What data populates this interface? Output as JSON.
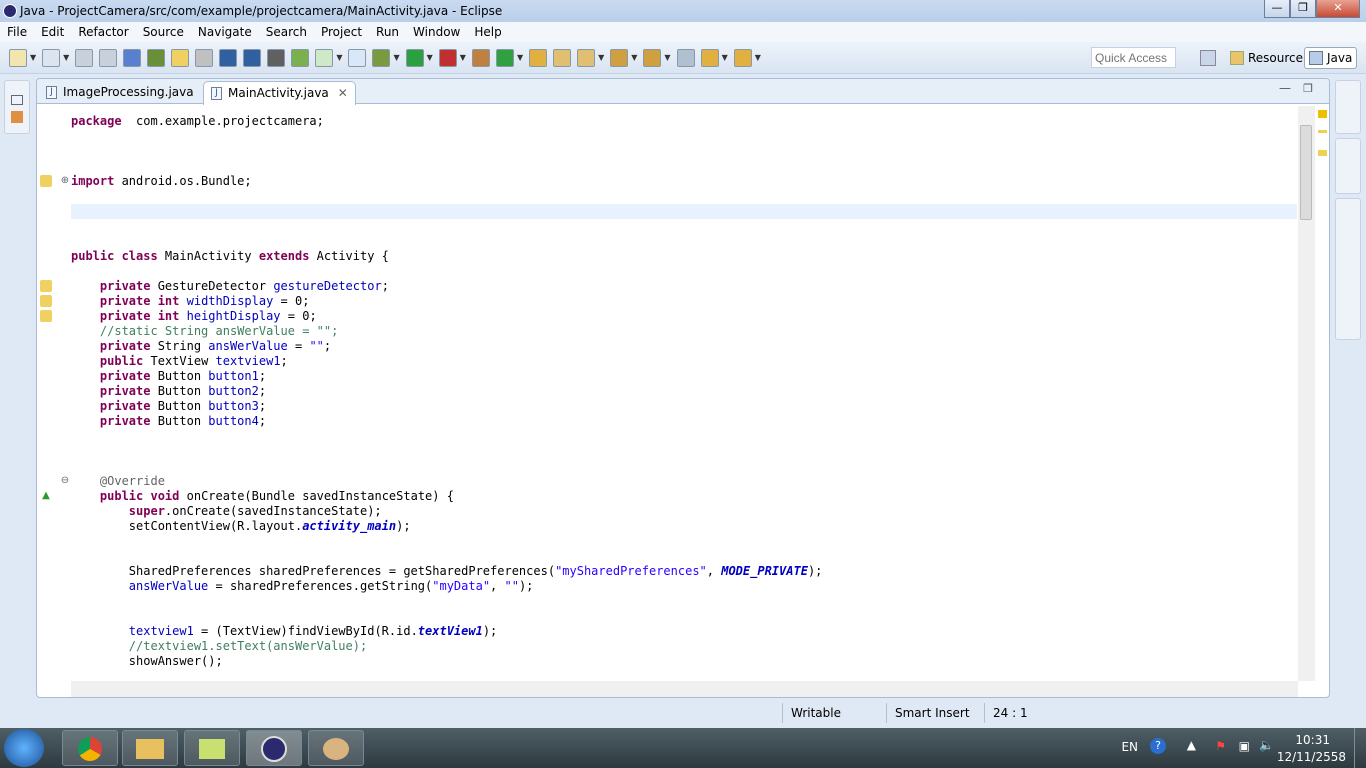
{
  "window": {
    "title": "Java - ProjectCamera/src/com/example/projectcamera/MainActivity.java - Eclipse",
    "buttons": [
      "minimize",
      "restore",
      "close"
    ]
  },
  "menu": [
    "File",
    "Edit",
    "Refactor",
    "Source",
    "Navigate",
    "Search",
    "Project",
    "Run",
    "Window",
    "Help"
  ],
  "toolbar": {
    "quick_access_placeholder": "Quick Access",
    "perspectives": [
      {
        "label": "Resource",
        "active": false
      },
      {
        "label": "Java",
        "active": true
      }
    ]
  },
  "editor": {
    "tabs": [
      {
        "label": "ImageProcessing.java",
        "active": false
      },
      {
        "label": "MainActivity.java",
        "active": true
      }
    ],
    "lines": [
      {
        "row": 0,
        "tokens": [
          [
            "kw",
            "package"
          ],
          [
            "",
            "  com.example.projectcamera;"
          ]
        ]
      },
      {
        "row": 4,
        "tokens": [
          [
            "kw",
            "import"
          ],
          [
            "",
            " android.os.Bundle;"
          ]
        ],
        "fold": "plus"
      },
      {
        "row": 6,
        "tokens": [],
        "current": true
      },
      {
        "row": 9,
        "tokens": [
          [
            "kw",
            "public class"
          ],
          [
            "",
            " MainActivity "
          ],
          [
            "kw",
            "extends"
          ],
          [
            "",
            " Activity {"
          ]
        ]
      },
      {
        "row": 11,
        "tokens": [
          [
            "",
            "    "
          ],
          [
            "kw",
            "private"
          ],
          [
            "",
            " GestureDetector "
          ],
          [
            "fd",
            "gestureDetector"
          ],
          [
            "",
            ";"
          ]
        ]
      },
      {
        "row": 12,
        "tokens": [
          [
            "",
            "    "
          ],
          [
            "kw",
            "private int"
          ],
          [
            " ",
            ""
          ],
          [
            "fd",
            " widthDisplay"
          ],
          [
            "",
            " = 0;"
          ]
        ]
      },
      {
        "row": 13,
        "tokens": [
          [
            "",
            "    "
          ],
          [
            "kw",
            "private int"
          ],
          [
            "fd",
            " heightDisplay"
          ],
          [
            "",
            " = 0;"
          ]
        ]
      },
      {
        "row": 14,
        "tokens": [
          [
            "cm",
            "    //static String ansWerValue = \"\";"
          ]
        ]
      },
      {
        "row": 15,
        "tokens": [
          [
            "",
            "    "
          ],
          [
            "kw",
            "private"
          ],
          [
            "",
            " String "
          ],
          [
            "fd",
            "ansWerValue"
          ],
          [
            "",
            " = "
          ],
          [
            "st",
            "\"\""
          ],
          [
            "",
            ";"
          ]
        ]
      },
      {
        "row": 16,
        "tokens": [
          [
            "",
            "    "
          ],
          [
            "kw",
            "public"
          ],
          [
            "",
            " TextView "
          ],
          [
            "fd",
            "textview1"
          ],
          [
            "",
            ";"
          ]
        ]
      },
      {
        "row": 17,
        "tokens": [
          [
            "",
            "    "
          ],
          [
            "kw",
            "private"
          ],
          [
            "",
            " Button "
          ],
          [
            "fd",
            "button1"
          ],
          [
            "",
            ";"
          ]
        ]
      },
      {
        "row": 18,
        "tokens": [
          [
            "",
            "    "
          ],
          [
            "kw",
            "private"
          ],
          [
            "",
            " Button "
          ],
          [
            "fd",
            "button2"
          ],
          [
            "",
            ";"
          ]
        ]
      },
      {
        "row": 19,
        "tokens": [
          [
            "",
            "    "
          ],
          [
            "kw",
            "private"
          ],
          [
            "",
            " Button "
          ],
          [
            "fd",
            "button3"
          ],
          [
            "",
            ";"
          ]
        ]
      },
      {
        "row": 20,
        "tokens": [
          [
            "",
            "    "
          ],
          [
            "kw",
            "private"
          ],
          [
            "",
            " Button "
          ],
          [
            "fd",
            "button4"
          ],
          [
            "",
            ";"
          ]
        ]
      },
      {
        "row": 24,
        "tokens": [
          [
            "an",
            "    @Override"
          ]
        ],
        "fold": "minus"
      },
      {
        "row": 25,
        "tokens": [
          [
            "",
            "    "
          ],
          [
            "kw",
            "public void"
          ],
          [
            "",
            " onCreate(Bundle "
          ],
          [
            "",
            "savedInstanceState) {"
          ]
        ]
      },
      {
        "row": 26,
        "tokens": [
          [
            "",
            "        "
          ],
          [
            "kw",
            "super"
          ],
          [
            "",
            ".onCreate(savedInstanceState);"
          ]
        ]
      },
      {
        "row": 27,
        "tokens": [
          [
            "",
            "        setContentView(R.layout."
          ],
          [
            "si",
            "activity_main"
          ],
          [
            "",
            ");"
          ]
        ]
      },
      {
        "row": 30,
        "tokens": [
          [
            "",
            "        SharedPreferences sharedPreferences = getSharedPreferences("
          ],
          [
            "st",
            "\"mySharedPreferences\""
          ],
          [
            "",
            ", "
          ],
          [
            "si",
            "MODE_PRIVATE"
          ],
          [
            "",
            ");"
          ]
        ]
      },
      {
        "row": 31,
        "tokens": [
          [
            "fd",
            "        ansWerValue"
          ],
          [
            "",
            " = sharedPreferences.getString("
          ],
          [
            "st",
            "\"myData\""
          ],
          [
            "",
            ", "
          ],
          [
            "st",
            "\"\""
          ],
          [
            "",
            ");"
          ]
        ]
      },
      {
        "row": 34,
        "tokens": [
          [
            "fd",
            "        textview1"
          ],
          [
            "",
            " = (TextView)findViewById(R.id."
          ],
          [
            "si",
            "textView1"
          ],
          [
            "",
            ");"
          ]
        ]
      },
      {
        "row": 35,
        "tokens": [
          [
            "cm",
            "        //textview1.setText(ansWerValue);"
          ]
        ]
      },
      {
        "row": 36,
        "tokens": [
          [
            "",
            "        showAnswer();"
          ]
        ]
      }
    ]
  },
  "status": {
    "mode": "Writable",
    "insert": "Smart Insert",
    "position": "24 : 1"
  },
  "tray": {
    "lang": "EN",
    "time": "10:31",
    "date": "12/11/2558"
  }
}
